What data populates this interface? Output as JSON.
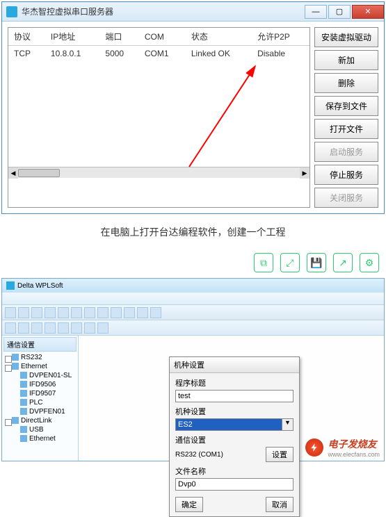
{
  "window1": {
    "title": "华杰智控虚拟串口服务器",
    "columns": [
      "协议",
      "IP地址",
      "端口",
      "COM",
      "状态",
      "允许P2P"
    ],
    "row": {
      "protocol": "TCP",
      "ip": "10.8.0.1",
      "port": "5000",
      "com": "COM1",
      "status": "Linked OK",
      "p2p": "Disable"
    },
    "buttons": {
      "install_driver": "安装虚拟驱动",
      "add": "新加",
      "delete": "删除",
      "save_file": "保存到文件",
      "open_file": "打开文件",
      "start_service": "启动服务",
      "stop_service": "停止服务",
      "close_service": "关闭服务"
    }
  },
  "caption": "在电脑上打开台达编程软件，创建一个工程",
  "window2": {
    "title": "Delta WPLSoft",
    "sidebar_title": "通信设置",
    "tree": {
      "rs232": "RS232",
      "ethernet": "Ethernet",
      "dvpen01": "DVPEN01-SL",
      "ifd9506": "IFD9506",
      "ifd9507": "IFD9507",
      "plc": "PLC",
      "dvppf02": "DVPFEN01",
      "directlink": "DirectLink",
      "usb": "USB",
      "ethernet2": "Ethernet"
    },
    "dialog": {
      "title": "机种设置",
      "program_title_label": "程序标题",
      "program_title_value": "test",
      "model_label": "机种设置",
      "model_value": "ES2",
      "comm_label": "通信设置",
      "comm_value": "RS232 (COM1)",
      "setting_btn": "设置",
      "file_label": "文件名称",
      "file_value": "Dvp0",
      "ok": "确定",
      "cancel": "取消"
    }
  },
  "footer": {
    "brand": "电子发烧友",
    "sub": "www.elecfans.com"
  }
}
